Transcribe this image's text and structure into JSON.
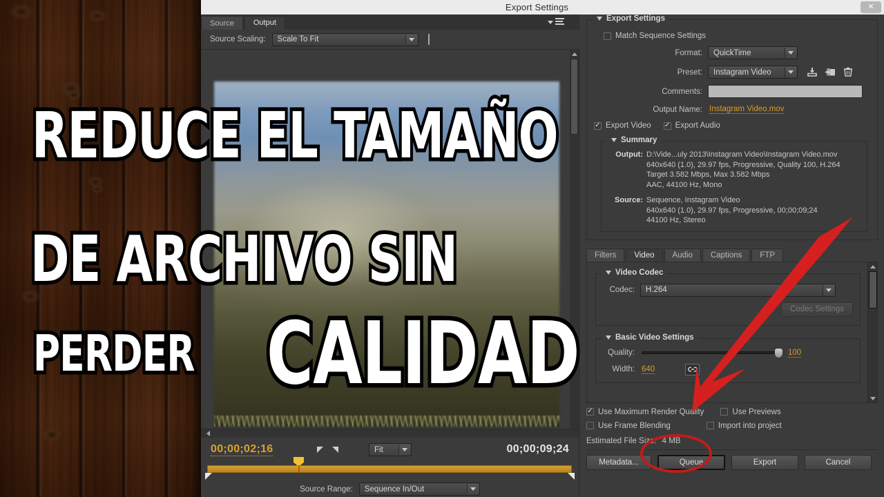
{
  "window": {
    "title": "Export Settings",
    "close_label": "✕"
  },
  "left_pane": {
    "tabs": [
      {
        "label": "Source",
        "active": false
      },
      {
        "label": "Output",
        "active": true
      }
    ],
    "panel_menu_icon": "panel-menu-icon",
    "source_scaling": {
      "label": "Source Scaling:",
      "value": "Scale To Fit"
    },
    "transport": {
      "current_time": "00;00;02;16",
      "total_time": "00;00;09;24",
      "zoom_level": "Fit",
      "source_range_label": "Source Range:",
      "source_range_value": "Sequence In/Out",
      "mark_in_icon": "mark-in-icon",
      "mark_out_icon": "mark-out-icon"
    }
  },
  "export_settings": {
    "group_title": "Export Settings",
    "match_sequence": {
      "label": "Match Sequence Settings",
      "checked": false
    },
    "format": {
      "label": "Format:",
      "value": "QuickTime"
    },
    "preset": {
      "label": "Preset:",
      "value": "Instagram Video"
    },
    "preset_icons": [
      "save-preset-icon",
      "import-preset-icon",
      "delete-preset-icon"
    ],
    "comments": {
      "label": "Comments:",
      "value": "",
      "placeholder": ""
    },
    "output_name": {
      "label": "Output Name:",
      "value": "Instagram Video.mov"
    },
    "export_video": {
      "label": "Export Video",
      "checked": true
    },
    "export_audio": {
      "label": "Export Audio",
      "checked": true
    },
    "summary": {
      "title": "Summary",
      "output_key": "Output:",
      "output_lines": [
        "D:\\Vide...uly 2013\\Instagram Video\\Instagram Video.mov",
        "640x640 (1.0), 29.97 fps, Progressive, Quality 100, H.264",
        "Target 3.582 Mbps, Max 3.582 Mbps",
        "AAC, 44100 Hz, Mono"
      ],
      "source_key": "Source:",
      "source_lines": [
        "Sequence, Instagram Video",
        "640x640 (1.0), 29.97 fps, Progressive, 00;00;09;24",
        "44100 Hz, Stereo"
      ]
    }
  },
  "settings_tabs": [
    {
      "label": "Filters",
      "active": false
    },
    {
      "label": "Video",
      "active": true
    },
    {
      "label": "Audio",
      "active": false
    },
    {
      "label": "Captions",
      "active": false
    },
    {
      "label": "FTP",
      "active": false
    }
  ],
  "video_tab": {
    "video_codec": {
      "group_title": "Video Codec",
      "codec_label": "Codec:",
      "codec_value": "H.264",
      "codec_settings_button": "Codec Settings"
    },
    "basic_video_settings": {
      "group_title": "Basic Video Settings",
      "quality_label": "Quality:",
      "quality_value": "100",
      "width_label": "Width:",
      "width_value": "640",
      "link_icon": "link-constrain-icon"
    }
  },
  "bottom": {
    "use_max_render_quality": {
      "label": "Use Maximum Render Quality",
      "checked": true
    },
    "use_previews": {
      "label": "Use Previews",
      "checked": false
    },
    "use_frame_blending": {
      "label": "Use Frame Blending",
      "checked": false
    },
    "import_into_project": {
      "label": "Import into project",
      "checked": false
    },
    "estimated_file_size_label": "Estimated File Size:",
    "estimated_file_size_value": "4 MB",
    "buttons": {
      "metadata": "Metadata...",
      "queue": "Queue",
      "export": "Export",
      "cancel": "Cancel"
    }
  },
  "overlay": {
    "line1": "REDUCE EL TAMAÑO",
    "line2": "DE ARCHIVO SIN",
    "line3": "PERDER",
    "line4": "CALIDAD"
  },
  "colors": {
    "accent_orange": "#d79b2b",
    "annotation_red": "#d61f1f",
    "panel_bg": "#3b3b3b",
    "titlebar_bg": "#ebebeb"
  }
}
